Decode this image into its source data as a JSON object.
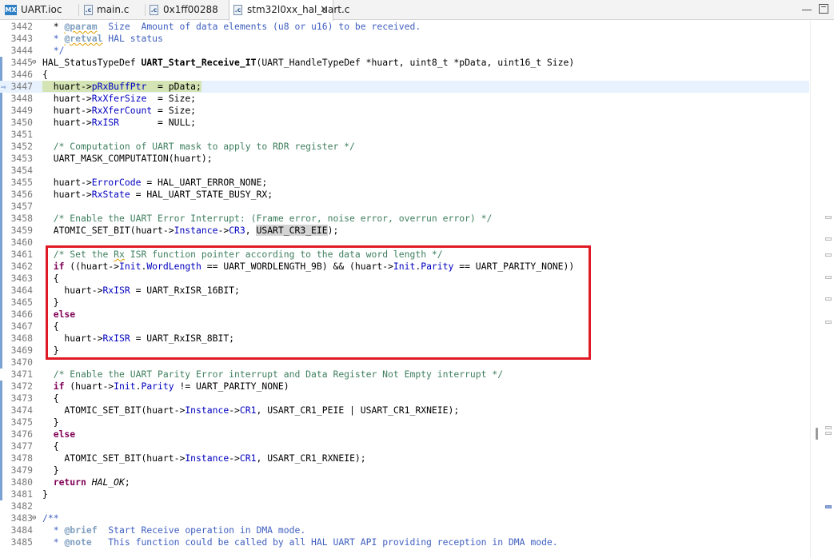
{
  "tabs": [
    {
      "label": "UART.ioc",
      "icon": "mx-icon",
      "active": false
    },
    {
      "label": "main.c",
      "icon": "c-file-icon",
      "active": false
    },
    {
      "label": "0x1ff00288",
      "icon": "c-file-icon",
      "active": false
    },
    {
      "label": "stm32l0xx_hal_uart.c",
      "icon": "c-file-icon",
      "active": true
    }
  ],
  "mx_icon_text": "MX",
  "c_icon_text": ".c",
  "close_glyph": "✕",
  "fold_glyph": "⊖",
  "exec_glyph": "⇨",
  "lines": [
    {
      "n": "3442",
      "html": "  * <span class=\"jt squig\">@param</span><span class=\"jd\">  Size  Amount of data elements (u8 or u16) to be received.</span>"
    },
    {
      "n": "3443",
      "html": "<span class=\"jd\">  * </span><span class=\"jt squig\">@retval</span><span class=\"jd\"> HAL status</span>"
    },
    {
      "n": "3444",
      "html": "<span class=\"jd\">  */</span>"
    },
    {
      "n": "3445",
      "html": "HAL_StatusTypeDef <span class=\"fnb\">UART_Start_Receive_IT</span>(UART_HandleTypeDef *huart, uint8_t *pData, uint16_t Size)",
      "fold": true
    },
    {
      "n": "3446",
      "html": "{"
    },
    {
      "n": "3447",
      "html": "<span class=\"hl-code\">  huart-&gt;<span class=\"fld\">pRxBuffPtr</span>  = pData;</span>",
      "hl": true,
      "arrow": true
    },
    {
      "n": "3448",
      "html": "  huart-&gt;<span class=\"fld\">RxXferSize</span>  = Size;"
    },
    {
      "n": "3449",
      "html": "  huart-&gt;<span class=\"fld\">RxXferCount</span> = Size;"
    },
    {
      "n": "3450",
      "html": "  huart-&gt;<span class=\"fld\">RxISR</span>       = NULL;"
    },
    {
      "n": "3451",
      "html": ""
    },
    {
      "n": "3452",
      "html": "  <span class=\"cm\">/* Computation of UART mask to apply to RDR register */</span>"
    },
    {
      "n": "3453",
      "html": "  UART_MASK_COMPUTATION(huart);"
    },
    {
      "n": "3454",
      "html": ""
    },
    {
      "n": "3455",
      "html": "  huart-&gt;<span class=\"fld\">ErrorCode</span> = HAL_UART_ERROR_NONE;"
    },
    {
      "n": "3456",
      "html": "  huart-&gt;<span class=\"fld\">RxState</span> = HAL_UART_STATE_BUSY_RX;"
    },
    {
      "n": "3457",
      "html": ""
    },
    {
      "n": "3458",
      "html": "  <span class=\"cm\">/* Enable the UART Error Interrupt: (Frame error, noise error, overrun error) */</span>"
    },
    {
      "n": "3459",
      "html": "  ATOMIC_SET_BIT(huart-&gt;<span class=\"fld\">Instance</span>-&gt;<span class=\"fld\">CR3</span>, <span class=\"sel-code\">USART_CR3_EIE</span>);"
    },
    {
      "n": "3460",
      "html": ""
    },
    {
      "n": "3461",
      "html": "  <span class=\"cm\">/* Set the <span class=\"squig\">Rx</span> ISR function pointer according to the data word length */</span>"
    },
    {
      "n": "3462",
      "html": "  <span class=\"k\">if</span> ((huart-&gt;<span class=\"fld\">Init</span>.<span class=\"fld\">WordLength</span> == UART_WORDLENGTH_9B) &amp;&amp; (huart-&gt;<span class=\"fld\">Init</span>.<span class=\"fld\">Parity</span> == UART_PARITY_NONE))"
    },
    {
      "n": "3463",
      "html": "  {"
    },
    {
      "n": "3464",
      "html": "    huart-&gt;<span class=\"fld\">RxISR</span> = UART_RxISR_16BIT;"
    },
    {
      "n": "3465",
      "html": "  }"
    },
    {
      "n": "3466",
      "html": "  <span class=\"k\">else</span>"
    },
    {
      "n": "3467",
      "html": "  {"
    },
    {
      "n": "3468",
      "html": "    huart-&gt;<span class=\"fld\">RxISR</span> = UART_RxISR_8BIT;"
    },
    {
      "n": "3469",
      "html": "  }"
    },
    {
      "n": "3470",
      "html": ""
    },
    {
      "n": "3471",
      "html": "  <span class=\"cm\">/* Enable the UART Parity Error interrupt and Data Register Not Empty interrupt */</span>"
    },
    {
      "n": "3472",
      "html": "  <span class=\"k\">if</span> (huart-&gt;<span class=\"fld\">Init</span>.<span class=\"fld\">Parity</span> != UART_PARITY_NONE)"
    },
    {
      "n": "3473",
      "html": "  {"
    },
    {
      "n": "3474",
      "html": "    ATOMIC_SET_BIT(huart-&gt;<span class=\"fld\">Instance</span>-&gt;<span class=\"fld\">CR1</span>, USART_CR1_PEIE | USART_CR1_RXNEIE);"
    },
    {
      "n": "3475",
      "html": "  }"
    },
    {
      "n": "3476",
      "html": "  <span class=\"k\">else</span>"
    },
    {
      "n": "3477",
      "html": "  {"
    },
    {
      "n": "3478",
      "html": "    ATOMIC_SET_BIT(huart-&gt;<span class=\"fld\">Instance</span>-&gt;<span class=\"fld\">CR1</span>, USART_CR1_RXNEIE);"
    },
    {
      "n": "3479",
      "html": "  }"
    },
    {
      "n": "3480",
      "html": "  <span class=\"k\">return</span> <span class=\"it\">HAL_OK</span>;"
    },
    {
      "n": "3481",
      "html": "}"
    },
    {
      "n": "3482",
      "html": ""
    },
    {
      "n": "3483",
      "html": "<span class=\"jd\">/**</span>",
      "fold": true
    },
    {
      "n": "3484",
      "html": "<span class=\"jd\">  * </span><span class=\"jt\">@brief</span><span class=\"jd\">  Start Receive operation in DMA mode.</span>"
    },
    {
      "n": "3485",
      "html": "<span class=\"jd\">  * </span><span class=\"jt\">@note</span><span class=\"jd\">   This function could be called by all HAL UART API providing reception in DMA mode.</span>"
    }
  ]
}
